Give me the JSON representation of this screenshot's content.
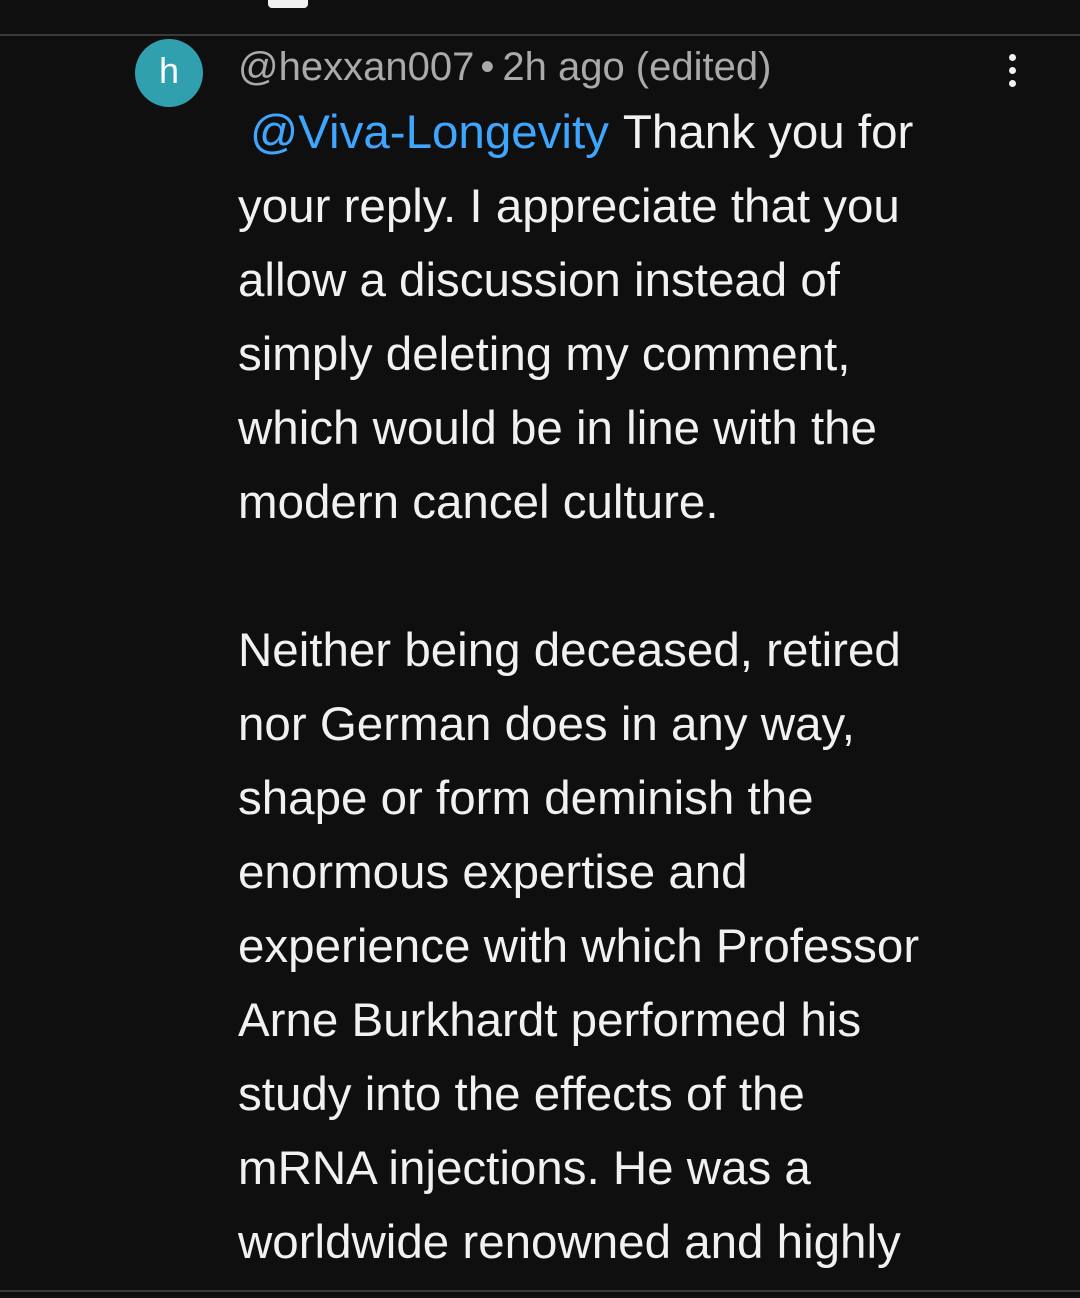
{
  "comment": {
    "avatar_letter": "h",
    "avatar_color": "#31a0ae",
    "author": "@hexxan007",
    "separator": "•",
    "timestamp": "2h ago (edited)",
    "menu_icon": "more-vert-icon",
    "mention": "@Viva-Longevity",
    "mention_color": "#3ea6ff",
    "first_line_rest": "Thank you for",
    "lines": [
      "your reply. I appreciate that you",
      "allow a discussion instead of",
      "simply deleting my comment,",
      "which would be in line with the",
      "modern cancel culture."
    ],
    "paragraph2_lines": [
      "Neither being deceased, retired",
      "nor German does in any way,",
      "shape or form deminish the",
      "enormous expertise and",
      "experience with which Professor",
      "Arne Burkhardt performed his",
      "study into the effects of the",
      "mRNA injections. He was a",
      "worldwide renowned and highly"
    ]
  }
}
